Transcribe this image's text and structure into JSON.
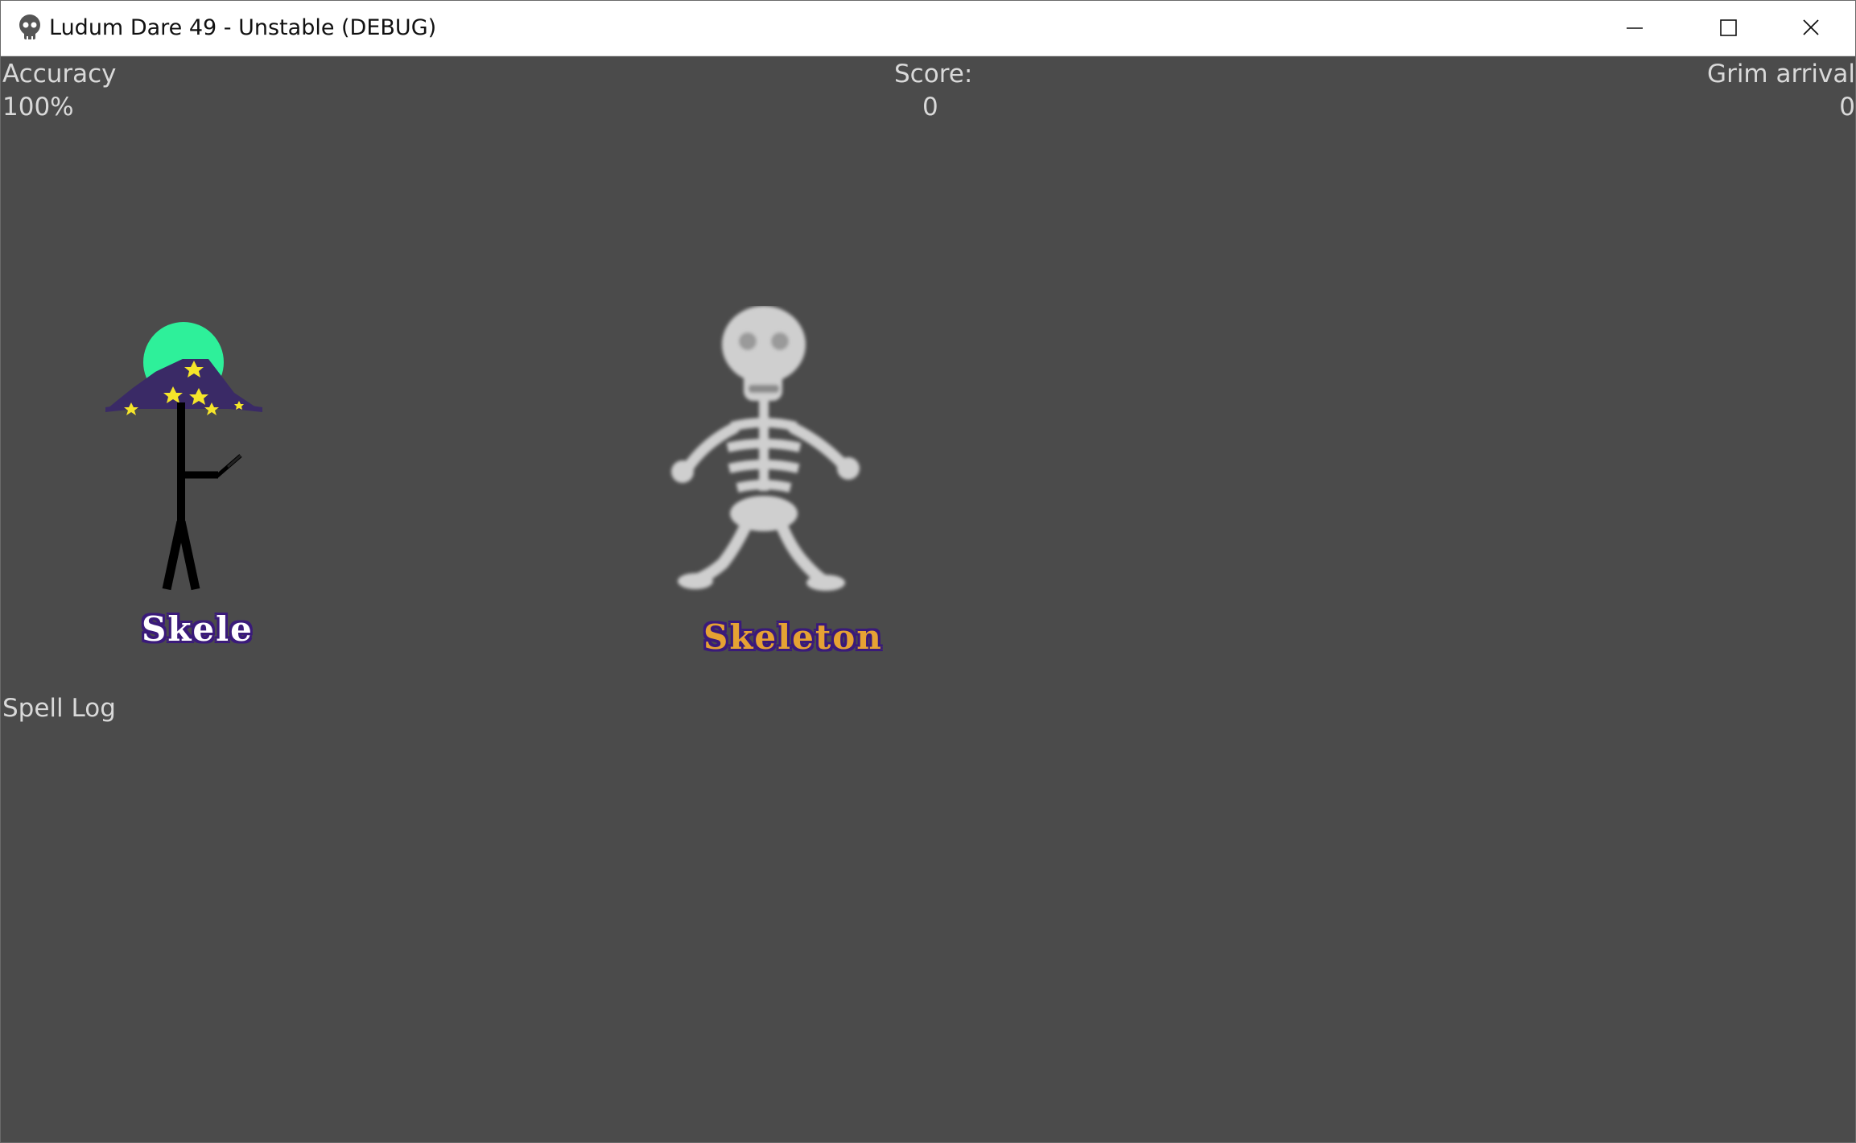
{
  "window": {
    "title": "Ludum Dare 49 - Unstable (DEBUG)",
    "icon": "skull-icon",
    "controls": [
      "minimize-icon",
      "maximize-icon",
      "close-icon"
    ]
  },
  "hud": {
    "accuracy_label": "Accuracy",
    "accuracy_value": "100%",
    "score_label": "Score:",
    "score_value": "0",
    "grim_label": "Grim arrival",
    "grim_value": "0"
  },
  "player": {
    "name": "Skele"
  },
  "enemy": {
    "name": "Skeleton"
  },
  "spell_log": {
    "label": "Spell Log"
  },
  "colors": {
    "background": "#4b4b4b",
    "hud_text": "#d9d9d9",
    "wizard_hat": "#3a2a66",
    "wizard_face": "#2ef09a",
    "stars": "#f5e52a",
    "skeleton_bone": "#cfcfcf",
    "player_name": "#ffffff",
    "enemy_name": "#e6a233",
    "name_outline": "#3a1a7a"
  }
}
